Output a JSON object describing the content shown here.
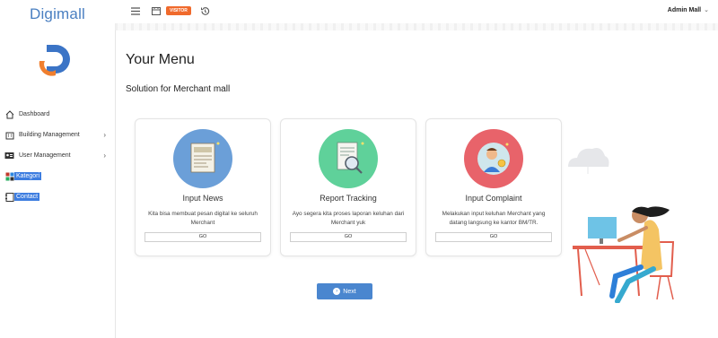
{
  "app": {
    "name": "Digimall"
  },
  "sidebar": {
    "items": [
      {
        "label": "Dashboard",
        "icon": "home-icon",
        "has_submenu": false
      },
      {
        "label": "Building Management",
        "icon": "building-icon",
        "has_submenu": true
      },
      {
        "label": "User Management",
        "icon": "id-card-icon",
        "has_submenu": true
      },
      {
        "label": "Kategori",
        "icon": "category-icon",
        "has_submenu": false,
        "highlighted": true
      },
      {
        "label": "Contact",
        "icon": "contact-icon",
        "has_submenu": false,
        "highlighted": true
      }
    ]
  },
  "topbar": {
    "visitor_badge": "VISITOR",
    "user_name": "Admin Mall",
    "icons": [
      "menu-icon",
      "calendar-icon",
      "history-icon"
    ]
  },
  "main": {
    "title": "Your Menu",
    "subtitle": "Solution for Merchant mall",
    "cards": [
      {
        "title": "Input News",
        "description": "Kita bisa membuat pesan digital ke seluruh Merchant",
        "button": "GO",
        "color": "#6b9fd8",
        "icon": "news-icon"
      },
      {
        "title": "Report Tracking",
        "description": "Ayo segera kita proses laporan keluhan dari Merchant yuk",
        "button": "GO",
        "color": "#5fd19a",
        "icon": "report-icon"
      },
      {
        "title": "Input Complaint",
        "description": "Melakukan input keluhan Merchant yang datang langsung ke kantor BM/TR.",
        "button": "GO",
        "color": "#e8636a",
        "icon": "complaint-icon"
      }
    ],
    "next_button": "Next"
  },
  "colors": {
    "brand": "#4a7fc1",
    "accent": "#f06a2c",
    "primary_button": "#4a86cf"
  }
}
